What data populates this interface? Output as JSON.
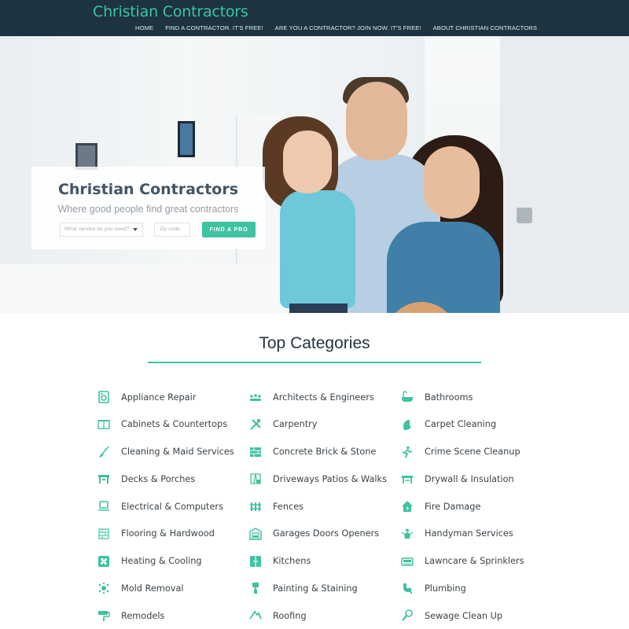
{
  "header": {
    "logo": "Christian Contractors",
    "nav": [
      "HOME",
      "FIND A CONTRACTOR. IT'S FREE!",
      "ARE YOU A CONTRACTOR? JOIN NOW. IT'S FREE!",
      "ABOUT CHRISTIAN CONTRACTORS"
    ]
  },
  "hero": {
    "title": "Christian Contractors",
    "subtitle": "Where good people find great contractors",
    "service_placeholder": "What service do you need?",
    "zip_placeholder": "Zip code",
    "button": "FIND A PRO"
  },
  "categories": {
    "title": "Top Categories",
    "accent_color": "#3ec2a2",
    "items": [
      {
        "label": "Appliance Repair",
        "icon": "appliance-icon"
      },
      {
        "label": "Architects & Engineers",
        "icon": "architects-icon"
      },
      {
        "label": "Bathrooms",
        "icon": "bathtub-icon"
      },
      {
        "label": "Cabinets & Countertops",
        "icon": "cabinet-icon"
      },
      {
        "label": "Carpentry",
        "icon": "tools-icon"
      },
      {
        "label": "Carpet Cleaning",
        "icon": "carpet-icon"
      },
      {
        "label": "Cleaning & Maid Services",
        "icon": "broom-icon"
      },
      {
        "label": "Concrete Brick & Stone",
        "icon": "brick-icon"
      },
      {
        "label": "Crime Scene Cleanup",
        "icon": "crime-scene-icon"
      },
      {
        "label": "Decks & Porches",
        "icon": "deck-icon"
      },
      {
        "label": "Driveways Patios & Walks",
        "icon": "driveway-icon"
      },
      {
        "label": "Drywall & Insulation",
        "icon": "drywall-icon"
      },
      {
        "label": "Electrical & Computers",
        "icon": "laptop-icon"
      },
      {
        "label": "Fences",
        "icon": "fence-icon"
      },
      {
        "label": "Fire Damage",
        "icon": "fire-icon"
      },
      {
        "label": "Flooring & Hardwood",
        "icon": "flooring-icon"
      },
      {
        "label": "Garages Doors Openers",
        "icon": "garage-icon"
      },
      {
        "label": "Handyman Services",
        "icon": "handyman-icon"
      },
      {
        "label": "Heating & Cooling",
        "icon": "fan-icon"
      },
      {
        "label": "Kitchens",
        "icon": "kitchen-icon"
      },
      {
        "label": "Lawncare & Sprinklers",
        "icon": "lawnmower-icon"
      },
      {
        "label": "Mold Removal",
        "icon": "mold-icon"
      },
      {
        "label": "Painting & Staining",
        "icon": "paint-icon"
      },
      {
        "label": "Plumbing",
        "icon": "plumbing-icon"
      },
      {
        "label": "Remodels",
        "icon": "roller-icon"
      },
      {
        "label": "Roofing",
        "icon": "roof-icon"
      },
      {
        "label": "Sewage Clean Up",
        "icon": "sewage-icon"
      }
    ]
  }
}
